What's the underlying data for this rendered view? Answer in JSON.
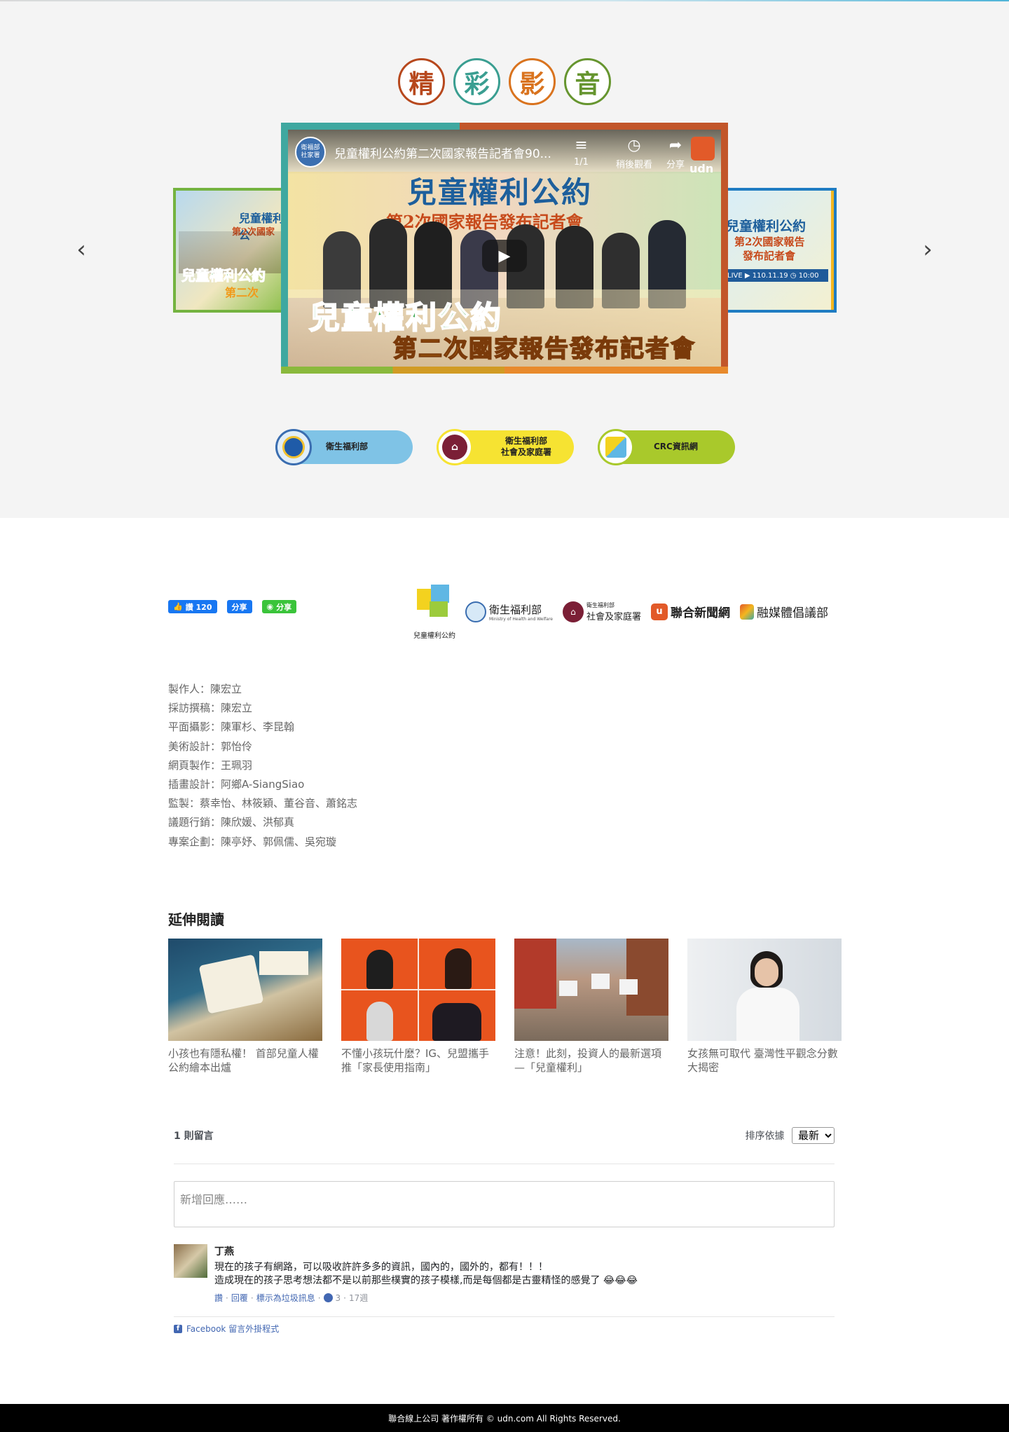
{
  "media": {
    "title_chars": [
      {
        "char": "精",
        "color": "#b7481d"
      },
      {
        "char": "彩",
        "color": "#3a9e91"
      },
      {
        "char": "影",
        "color": "#d9731e"
      },
      {
        "char": "音",
        "color": "#66952f"
      }
    ],
    "prev_arrow": "‹",
    "next_arrow": "›",
    "video": {
      "channel": "衛福部\n社家署",
      "title": "兒童權利公約第二次國家報告記者會90...",
      "counter": "1/1",
      "watch_later": "稍後觀看",
      "share": "分享",
      "brand": "udn",
      "headline": "兒童權利公約",
      "subheadline": "第2次國家報告發布記者會",
      "banner_line1": "兒童權利公約",
      "banner_line2": "第二次國家報告發布記者會"
    },
    "side_left": {
      "line1": "兒童權利公",
      "line2": "第2次國家",
      "banner": "兒童權利公約",
      "banner2": "第二次"
    },
    "side_right": {
      "line1": "兒童權利公約",
      "line2": "第2次國家報告",
      "line3": "發布記者會",
      "live": "LIVE ▶ 110.11.19 ◷ 10:00"
    },
    "org_links": [
      {
        "label": "衛生福利部",
        "color": "#7fc3e6",
        "logo_border": "#3a6db0"
      },
      {
        "label": "衛生福利部\n社會及家庭署",
        "color": "#f6e332",
        "logo_border": "#7b1f36"
      },
      {
        "label": "CRC資訊網",
        "color": "#a9c92b",
        "logo_border": "#8fbf2b"
      }
    ]
  },
  "share": {
    "like_label": "讚 120",
    "fb_share": "分享",
    "line_share": "分享"
  },
  "partner_logos": [
    {
      "name": "兒童權利公約"
    },
    {
      "name": "衛生福利部",
      "sub": "Ministry of Health and Welfare"
    },
    {
      "name": "社會及家庭署",
      "top": "衛生福利部"
    },
    {
      "name": "聯合新聞網"
    },
    {
      "name": "融媒體倡議部"
    }
  ],
  "credits": [
    "製作人：陳宏立",
    "採訪撰稿：陳宏立",
    "平面攝影：陳軍杉、李昆翰",
    "美術設計：郭怡伶",
    "網頁製作：王珮羽",
    "插畫設計：阿鄉A-SiangSiao",
    "監製：蔡幸怡、林筱穎、董谷音、蕭銘志",
    "議題行銷：陳欣媛、洪郁真",
    "專案企劃：陳亭妤、郭佩儒、吳宛璇"
  ],
  "related": {
    "title": "延伸閱讀",
    "items": [
      {
        "text": "小孩也有隱私權！ 首部兒童人權公約繪本出爐"
      },
      {
        "text": "不懂小孩玩什麼？IG、兒盟攜手推「家長使用指南」"
      },
      {
        "text": "注意！此刻，投資人的最新選項—「兒童權利」"
      },
      {
        "text": "女孩無可取代 臺灣性平觀念分數大揭密"
      }
    ]
  },
  "comments": {
    "count_label": "1 則留言",
    "sort_label": "排序依據",
    "sort_value": "最新",
    "placeholder": "新增回應……",
    "items": [
      {
        "name": "丁燕",
        "line1": "現在的孩子有網路，可以吸收許許多多的資訊，國內的，國外的，都有！！！",
        "line2": "造成現在的孩子思考想法都不是以前那些樸實的孩子模樣,而是每個都是古靈精怪的感覺了 😂😂😂",
        "like": "讚",
        "reply": "回覆",
        "spam": "標示為垃圾訊息",
        "likes_count": "3",
        "time": "17週"
      }
    ],
    "plugin_label": "Facebook 留言外掛程式"
  },
  "footer": {
    "text": "聯合線上公司 著作權所有 © udn.com All Rights Reserved."
  }
}
